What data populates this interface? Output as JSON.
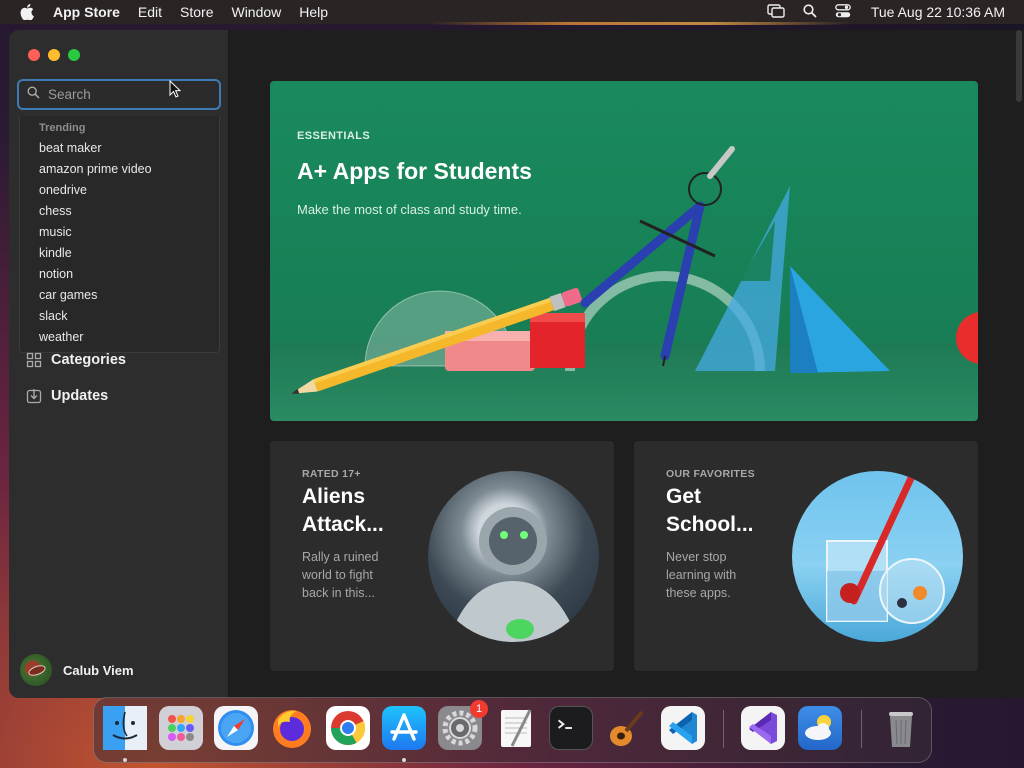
{
  "menubar": {
    "app_name": "App Store",
    "items": [
      "Edit",
      "Store",
      "Window",
      "Help"
    ],
    "clock": "Tue Aug 22  10:36 AM"
  },
  "sidebar": {
    "search": {
      "placeholder": "Search",
      "value": ""
    },
    "suggestions": {
      "heading": "Trending",
      "items": [
        "beat maker",
        "amazon prime video",
        "onedrive",
        "chess",
        "music",
        "kindle",
        "notion",
        "car games",
        "slack",
        "weather"
      ]
    },
    "nav": [
      {
        "label": "Categories",
        "icon": "grid-icon"
      },
      {
        "label": "Updates",
        "icon": "download-icon"
      }
    ],
    "user": {
      "name": "Calub Viem"
    }
  },
  "hero": {
    "eyebrow": "ESSENTIALS",
    "title": "A+ Apps for Students",
    "subtitle": "Make the most of class and study time.",
    "color": "#1a8a5e"
  },
  "cards": [
    {
      "eyebrow": "RATED 17+",
      "title": "Aliens Attack...",
      "description": "Rally a ruined world to fight back in this..."
    },
    {
      "eyebrow": "OUR FAVORITES",
      "title": "Get School...",
      "description": "Never stop learning with these apps."
    }
  ],
  "dock": {
    "apps": [
      "Finder",
      "Launchpad",
      "Safari",
      "Firefox",
      "Chrome",
      "App Store",
      "System Settings",
      "TextEdit",
      "Terminal",
      "GarageBand",
      "Visual Studio Code",
      "Visual Studio",
      "Weather",
      "Trash"
    ],
    "settings_badge": "1"
  }
}
